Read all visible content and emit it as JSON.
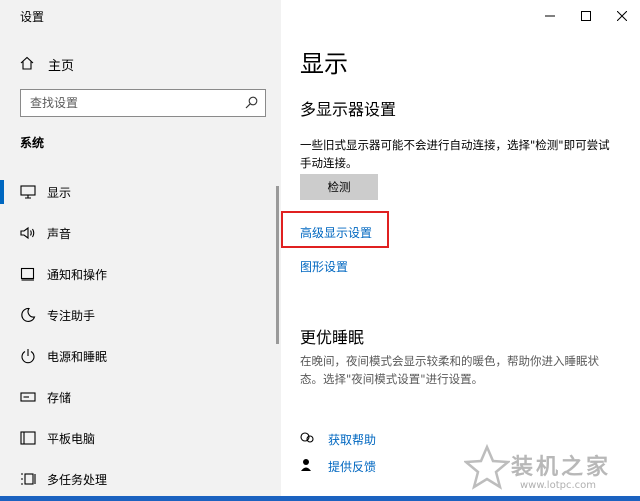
{
  "window": {
    "title": "设置"
  },
  "sidebar": {
    "home_label": "主页",
    "search_placeholder": "查找设置",
    "section_title": "系统",
    "items": [
      {
        "label": "显示",
        "icon": "monitor-icon",
        "active": true
      },
      {
        "label": "声音",
        "icon": "speaker-icon"
      },
      {
        "label": "通知和操作",
        "icon": "notification-icon"
      },
      {
        "label": "专注助手",
        "icon": "moon-icon"
      },
      {
        "label": "电源和睡眠",
        "icon": "power-icon"
      },
      {
        "label": "存储",
        "icon": "storage-icon"
      },
      {
        "label": "平板电脑",
        "icon": "tablet-icon"
      },
      {
        "label": "多任务处理",
        "icon": "multitask-icon"
      }
    ]
  },
  "main": {
    "title": "显示",
    "multi_display": {
      "heading": "多显示器设置",
      "description": "一些旧式显示器可能不会进行自动连接，选择\"检测\"即可尝试手动连接。",
      "detect_button": "检测"
    },
    "links": {
      "advanced_display": "高级显示设置",
      "graphics": "图形设置"
    },
    "sleep": {
      "heading": "更优睡眠",
      "description": "在晚间，夜间模式会显示较柔和的暖色，帮助你进入睡眠状态。选择\"夜间模式设置\"进行设置。"
    },
    "help": {
      "get_help": "获取帮助",
      "feedback": "提供反馈"
    }
  },
  "watermark": {
    "text": "装机之家",
    "url": "www.lotpc.com"
  },
  "colors": {
    "accent": "#0067c0",
    "highlight": "#e02020",
    "sidebar_bg": "#f2f2f2"
  }
}
